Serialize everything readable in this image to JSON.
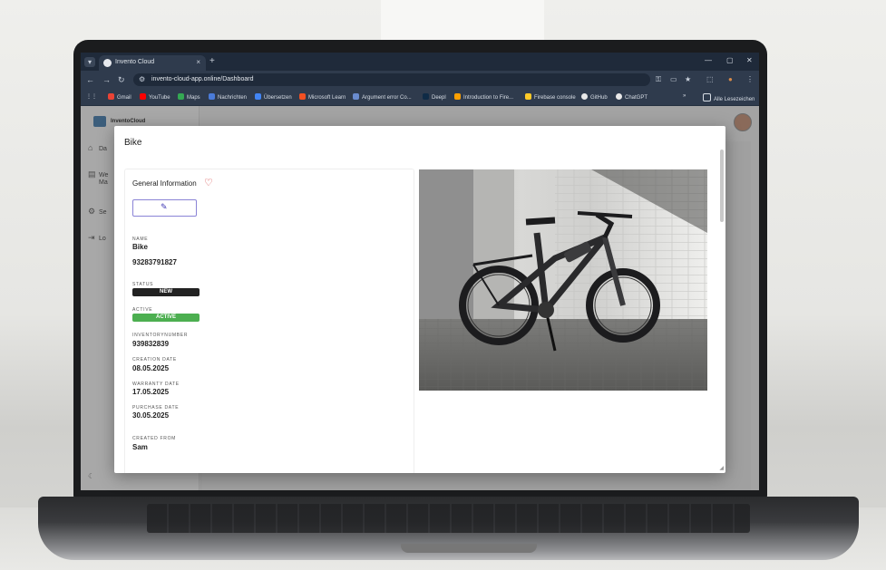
{
  "browser": {
    "tab_title": "Invento Cloud",
    "url": "invento-cloud-app.online/Dashboard",
    "bookmarks": [
      {
        "label": "Gmail",
        "color": "#ea4335"
      },
      {
        "label": "YouTube",
        "color": "#ff0000"
      },
      {
        "label": "Maps",
        "color": "#34a853"
      },
      {
        "label": "Nachrichten",
        "color": "#4a7bd8"
      },
      {
        "label": "Übersetzen",
        "color": "#4285f4"
      },
      {
        "label": "Microsoft Learn",
        "color": "#f25022"
      },
      {
        "label": "Argument error Co...",
        "color": "#6a8ccf"
      },
      {
        "label": "Deepl",
        "color": "#0f2b46"
      },
      {
        "label": "Introduction to Fire...",
        "color": "#ffa000"
      },
      {
        "label": "Firebase console",
        "color": "#ffca28"
      },
      {
        "label": "GitHub",
        "color": "#e8e8e8"
      },
      {
        "label": "ChatGPT",
        "color": "#e8e8e8"
      }
    ],
    "all_bookmarks": "Alle Lesezeichen"
  },
  "app": {
    "name": "InventoCloud",
    "nav": [
      {
        "label": "Da",
        "icon": "home-icon"
      },
      {
        "label": "We",
        "label2": "Ma",
        "icon": "clipboard-icon"
      },
      {
        "label": "Se",
        "icon": "gear-icon"
      },
      {
        "label": "Lo",
        "icon": "logout-icon"
      }
    ]
  },
  "modal": {
    "title": "Bike",
    "section_title": "General Information",
    "fields": {
      "name_label": "NAME",
      "name": "Bike",
      "serial": "93283791827",
      "status_label": "STATUS",
      "status": "NEW",
      "active_label": "ACTIVE",
      "active": "ACTIVE",
      "inventory_label": "INVENTORYNUMBER",
      "inventory": "939832839",
      "creation_label": "CREATION DATE",
      "creation": "08.05.2025",
      "warranty_label": "WARRANTY DATE",
      "warranty": "17.05.2025",
      "purchase_label": "PURCHASE DATE",
      "purchase": "30.05.2025",
      "created_from_label": "CREATED FROM",
      "created_from": "Sam"
    }
  },
  "colors": {
    "status_new": "#222222",
    "status_active": "#4caf50",
    "favorite": "#d43b3b",
    "edit_accent": "#3d36b3"
  }
}
